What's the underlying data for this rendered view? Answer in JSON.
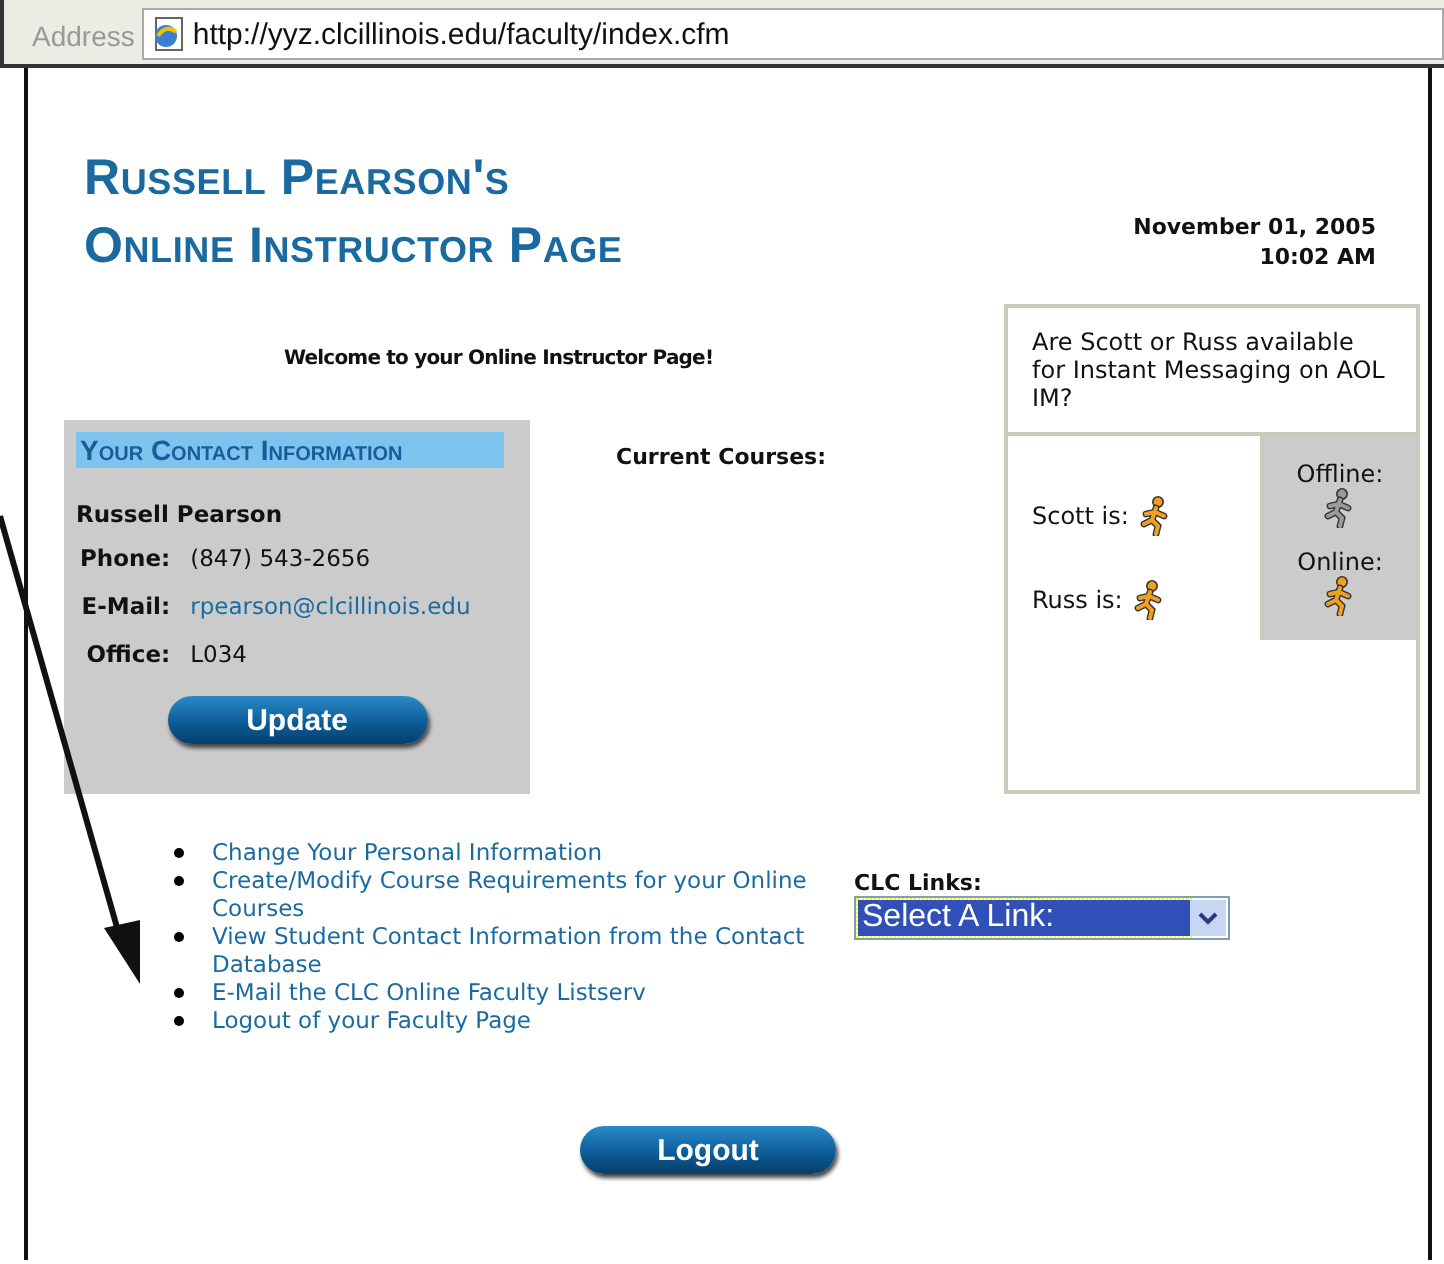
{
  "address_bar": {
    "label": "Address",
    "url": "http://yyz.clcillinois.edu/faculty/index.cfm"
  },
  "title_lines": [
    "Russell Pearson's",
    "Online Instructor Page"
  ],
  "date": "November 01, 2005",
  "time": "10:02 AM",
  "welcome": "Welcome to your Online Instructor Page!",
  "contact": {
    "heading": "Your Contact Information",
    "name": "Russell Pearson",
    "button": "Update",
    "fields": [
      {
        "label": "Phone:",
        "value": "(847) 543-2656",
        "kind": "text"
      },
      {
        "label": "E-Mail:",
        "value": "rpearson@clcillinois.edu",
        "kind": "link"
      },
      {
        "label": "Office:",
        "value": "L034",
        "kind": "text"
      }
    ]
  },
  "current_courses": "Current Courses:",
  "im_panel": {
    "question": "Are Scott or Russ available for Instant Messaging on AOL IM?",
    "people": [
      {
        "label": "Scott is:",
        "online": true
      },
      {
        "label": "Russ is:",
        "online": true
      }
    ],
    "legend": [
      {
        "label": "Offline:",
        "online": false
      },
      {
        "label": "Online:",
        "online": true
      }
    ]
  },
  "links": [
    "Change Your Personal Information",
    "Create/Modify Course Requirements for your Online Courses",
    "View Student Contact Information from the Contact Database",
    "E-Mail the CLC Online Faculty Listserv",
    "Logout of your Faculty Page"
  ],
  "clc_links": {
    "label": "CLC Links:",
    "value": "Select A Link:"
  },
  "logout_button": "Logout"
}
